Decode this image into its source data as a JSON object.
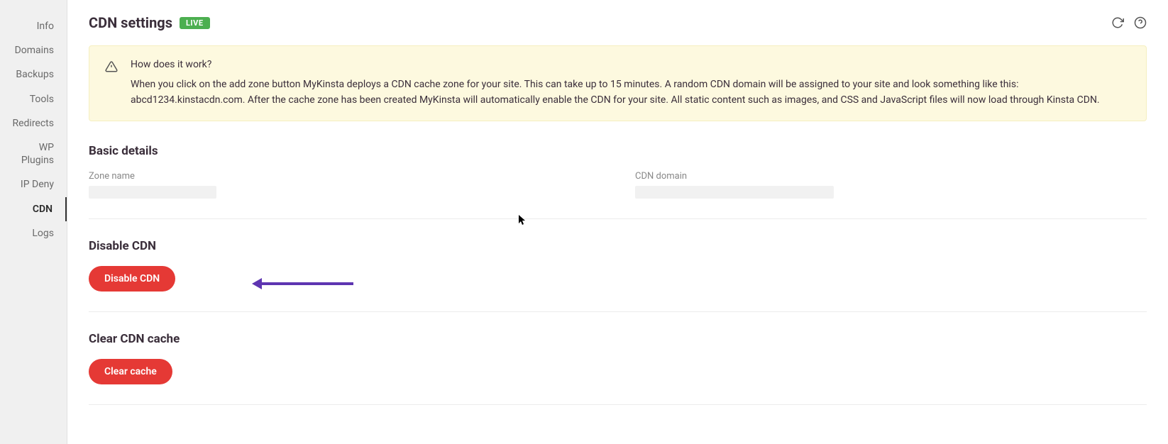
{
  "sidebar": {
    "items": [
      {
        "label": "Info"
      },
      {
        "label": "Domains"
      },
      {
        "label": "Backups"
      },
      {
        "label": "Tools"
      },
      {
        "label": "Redirects"
      },
      {
        "label": "WP Plugins"
      },
      {
        "label": "IP Deny"
      },
      {
        "label": "CDN"
      },
      {
        "label": "Logs"
      }
    ],
    "activeIndex": 7
  },
  "header": {
    "title": "CDN settings",
    "badge": "LIVE"
  },
  "notice": {
    "title": "How does it work?",
    "body": "When you click on the add zone button MyKinsta deploys a CDN cache zone for your site. This can take up to 15 minutes. A random CDN domain will be assigned to your site and look something like this: abcd1234.kinstacdn.com. After the cache zone has been created MyKinsta will automatically enable the CDN for your site. All static content such as images, and CSS and JavaScript files will now load through Kinsta CDN."
  },
  "basic": {
    "title": "Basic details",
    "zoneNameLabel": "Zone name",
    "zoneNameValue": "",
    "cdnDomainLabel": "CDN domain",
    "cdnDomainValue": ""
  },
  "disable": {
    "title": "Disable CDN",
    "button": "Disable CDN"
  },
  "clear": {
    "title": "Clear CDN cache",
    "button": "Clear cache"
  }
}
